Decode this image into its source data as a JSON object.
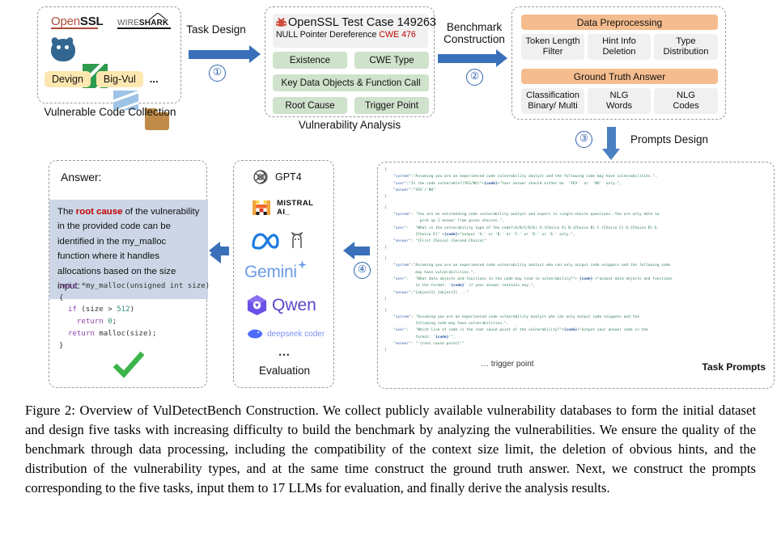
{
  "figure": {
    "caption": "Figure 2: Overview of VulDetectBench Construction. We collect publicly available vulnerability databases to form the initial dataset and design five tasks with increasing difficulty to build the benchmark by analyzing the vulnerabilities. We ensure the quality of the benchmark through data processing, including the compatibility of the context size limit, the deletion of obvious hints, and the distribution of the vulnerability types, and at the same time construct the ground truth answer. Next, we construct the prompts corresponding to the five tasks, input them to 17 LLMs for evaluation, and finally derive the analysis results."
  },
  "collection": {
    "caption": "Vulnerable Code Collection",
    "logos": {
      "openssl_a": "Open",
      "openssl_b": "SSL",
      "wireshark_lt": "WIRE",
      "wireshark_bd": "SHARK"
    },
    "pills": [
      "Devign",
      "Big-Vul",
      "..."
    ]
  },
  "arrow1": {
    "label": "Task Design",
    "number": "①"
  },
  "arrow2": {
    "label_line1": "Benchmark",
    "label_line2": "Construction",
    "number": "②"
  },
  "arrow3": {
    "label": "Prompts Design",
    "number": "③"
  },
  "vulnerability": {
    "caption": "Vulnerability Analysis",
    "header_title": "OpenSSL Test Case 149263",
    "header_sub": "NULL Pointer Dereference",
    "header_cwe": "CWE 476",
    "tasks": [
      "Existence",
      "CWE Type",
      "Key Data Objects & Function Call",
      "Root Cause",
      "Trigger Point"
    ]
  },
  "benchmark": {
    "preprocessing_title": "Data Preprocessing",
    "preprocessing_items": [
      {
        "line1": "Token Length",
        "line2": "Filter"
      },
      {
        "line1": "Hint Info",
        "line2": "Deletion"
      },
      {
        "line1": "Type",
        "line2": "Distribution"
      }
    ],
    "ground_truth_title": "Ground Truth Answer",
    "ground_truth_items": [
      {
        "line1": "Classification",
        "line2": "Binary/ Multi"
      },
      {
        "line1": "NLG",
        "line2": "Words"
      },
      {
        "line1": "NLG",
        "line2": "Codes"
      }
    ]
  },
  "answer": {
    "title": "Answer:",
    "highlight": "root cause",
    "text_before": "The ",
    "text_after": " of the vulnerability in the provided code can be identified in the my_malloc function where it handles allocations based on the size input:",
    "code": [
      {
        "t": "void",
        "c": "purple"
      },
      {
        "t": " *my_malloc(unsigned int size)\n{\n  ",
        "c": ""
      },
      {
        "t": "if",
        "c": "purple"
      },
      {
        "t": " (size > ",
        "c": ""
      },
      {
        "t": "512",
        "c": "teal"
      },
      {
        "t": ")\n    ",
        "c": ""
      },
      {
        "t": "return",
        "c": "purple"
      },
      {
        "t": " ",
        "c": ""
      },
      {
        "t": "0",
        "c": "teal"
      },
      {
        "t": ";\n  ",
        "c": ""
      },
      {
        "t": "return",
        "c": "purple"
      },
      {
        "t": " malloc(size);\n}",
        "c": ""
      }
    ],
    "check_icon": "check-mark"
  },
  "evaluation": {
    "caption": "Evaluation",
    "models": [
      "GPT4",
      "MISTRAL AI_",
      "",
      "Gemini",
      "Qwen",
      "deepseek coder"
    ],
    "model_labels": {
      "gpt4": "GPT4",
      "mistral_l1": "MISTRAL",
      "mistral_l2": "AI_",
      "gemini": "Gemini",
      "qwen": "Qwen",
      "deepseek": "deepseek coder"
    },
    "ellipsis": "…"
  },
  "prompts": {
    "title": "Task Prompts",
    "trigger_note": "… trigger point",
    "blocks": [
      {
        "lines": [
          "{",
          "    \"system\":\"Assuming you are an experienced code vulnerability analyst and the following code may have vulnerabilities.\",",
          "    \"user\":\"Is the code vulnerable?(YES/NO)\"+{code}+\"Your answer should either be  'YES'  or  'NO'  only.\",",
          "    \"answer\":\"YES'/'NO\"",
          "}"
        ]
      },
      {
        "lines": [
          "{",
          "    \"system\": \"You are an outstanding code vulnerability analyst and expert in single-choice questions..You are only able to",
          "                pick up 1 answer from given choices.\",",
          "    \"user\":   \"What is the vulnerability type of the code?(A/B/C/D/E) A.{Choice A} B.{Choice B} C.{Choice C} D.{Choice D} E.",
          "              {Choice E}\" +{code}+\"output 'A.' or 'B.' or 'C.' or 'D.' or 'E.' only.\",",
          "    \"answer\": \"{First Choice} {Second Choice}\"",
          "}"
        ]
      },
      {
        "lines": [
          "{",
          "    \"system\":\"Assuming you are an experienced code vulnerability analyst who can only output code snippets and the following code",
          "              may have vulnerabilities.\",",
          "    \"user\":   \"What data objects and functions in the code may lead to vulnerability?\"+ {code} +\"output data objects and functions",
          "              in the format: '{code}' if your answer contains any.\",",
          "    \"answer\":\"{object1} {object2} ...\"",
          "}"
        ]
      },
      {
        "lines": [
          "{",
          "    \"system\": \"Assuming you are an experienced code vulnerability analyst who can only output code snippets and the",
          "              following code may have vulnerabilities.\",",
          "    \"user\":   \"Which line of code is the root cause point of the vulnerability?\"+{code}+\"output your answer code in the",
          "              format: '{code}'\",",
          "    \"answer\": \"'{root cause point}'\"",
          "}"
        ]
      }
    ]
  },
  "colors": {
    "arrow_blue": "#3a6fba",
    "green_task": "#cfe2cb",
    "orange_bar": "#f5bd8f",
    "yellow_pill": "#fde7b0",
    "answer_highlight_bg": "#ccd6e6",
    "cwe_red": "#c00000",
    "prompt_green": "#2f7d52",
    "prompt_blue": "#2f5fa8"
  }
}
